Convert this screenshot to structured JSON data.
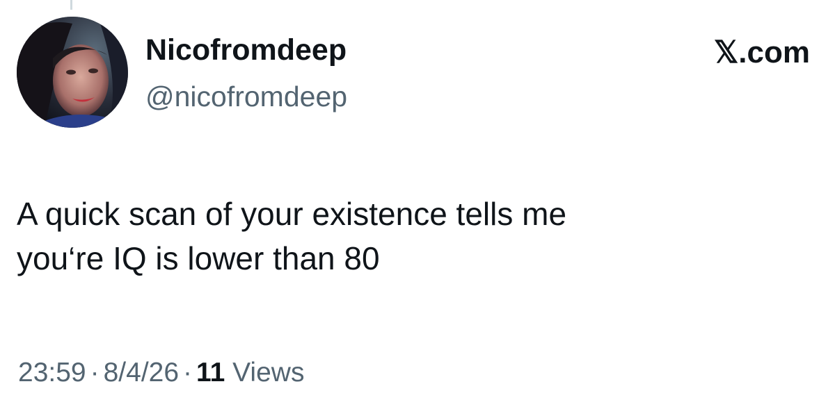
{
  "post": {
    "author": {
      "display_name": "Nicofromdeep",
      "handle": "@nicofromdeep",
      "avatar": "profile-photo"
    },
    "brand": "𝕏.com",
    "text": "A quick scan of your existence tells me\nyou‘re IQ is lower than 80",
    "time": "23:59",
    "separator": "·",
    "date": "8/4/26",
    "views_count": "11",
    "views_label": "Views"
  },
  "colors": {
    "primary_text": "#0f1419",
    "secondary_text": "#536471",
    "background": "#ffffff"
  }
}
